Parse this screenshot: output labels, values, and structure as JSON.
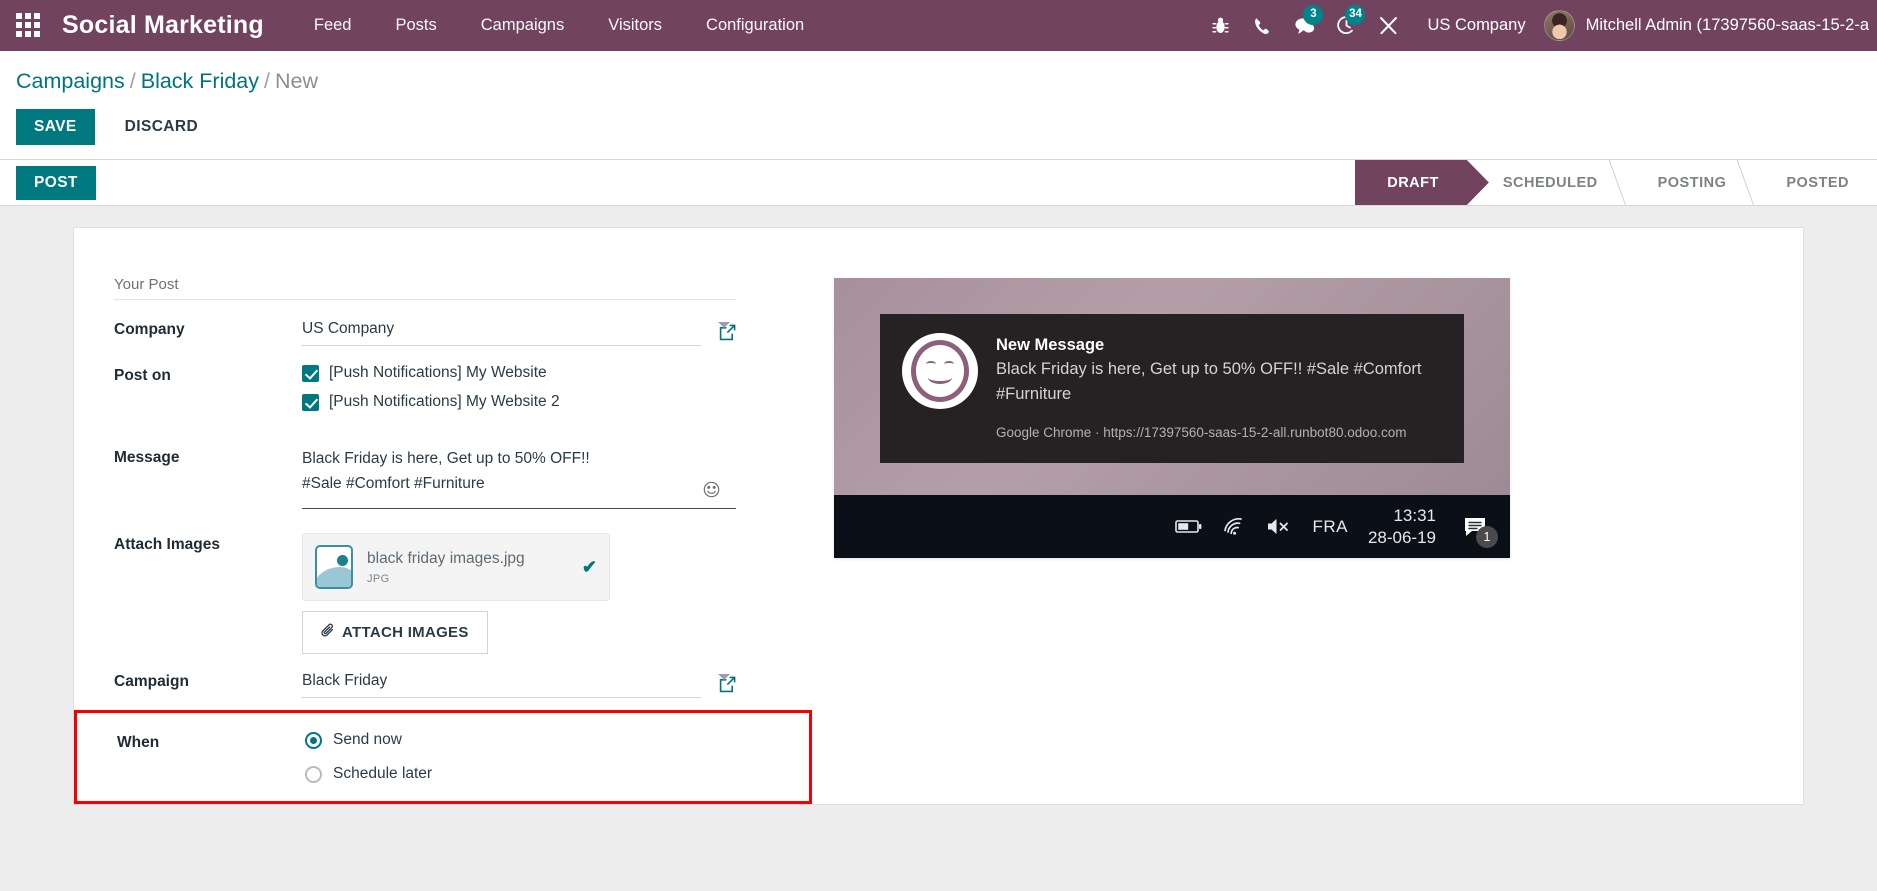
{
  "navbar": {
    "apps_icon": "apps-grid-icon",
    "brand": "Social Marketing",
    "menu": [
      {
        "label": "Feed"
      },
      {
        "label": "Posts"
      },
      {
        "label": "Campaigns"
      },
      {
        "label": "Visitors"
      },
      {
        "label": "Configuration"
      }
    ],
    "sys_icons": [
      {
        "name": "bug-icon",
        "badge": null
      },
      {
        "name": "phone-icon",
        "badge": null
      },
      {
        "name": "messages-icon",
        "badge": "3"
      },
      {
        "name": "activities-clock-icon",
        "badge": "34"
      },
      {
        "name": "tools-icon",
        "badge": null
      }
    ],
    "company": "US Company",
    "user": "Mitchell Admin (17397560-saas-15-2-a",
    "accent_color": "#71435f"
  },
  "breadcrumb": {
    "root": "Campaigns",
    "parent": "Black Friday",
    "current": "New",
    "separator": "/"
  },
  "control_panel": {
    "save_label": "SAVE",
    "discard_label": "DISCARD"
  },
  "statusbar": {
    "post_label": "POST",
    "stages": [
      {
        "label": "DRAFT",
        "active": true
      },
      {
        "label": "SCHEDULED",
        "active": false
      },
      {
        "label": "POSTING",
        "active": false
      },
      {
        "label": "POSTED",
        "active": false
      }
    ],
    "active_color": "#71435f"
  },
  "form": {
    "group_title": "Your Post",
    "company": {
      "label": "Company",
      "value": "US Company"
    },
    "post_on": {
      "label": "Post on",
      "accounts": [
        {
          "label": "[Push Notifications] My Website",
          "checked": true
        },
        {
          "label": "[Push Notifications] My Website 2",
          "checked": true
        }
      ]
    },
    "message": {
      "label": "Message",
      "line1": "Black Friday is here, Get up to 50% OFF!!",
      "line2": "#Sale #Comfort #Furniture",
      "emoji_icon": "emoji-smiley-icon"
    },
    "attach_images": {
      "label": "Attach Images",
      "file_name": "black friday images.jpg",
      "file_type": "JPG",
      "button_label": "ATTACH IMAGES",
      "button_icon": "paperclip-icon"
    },
    "campaign": {
      "label": "Campaign",
      "value": "Black Friday"
    },
    "when": {
      "label": "When",
      "options": [
        {
          "label": "Send now",
          "selected": true
        },
        {
          "label": "Schedule later",
          "selected": false
        }
      ],
      "highlight_color": "#f40000"
    }
  },
  "preview": {
    "notification": {
      "title": "New Message",
      "body": "Black Friday is here, Get up to 50% OFF!! #Sale #Comfort #Furniture",
      "source": "Google Chrome · https://17397560-saas-15-2-all.runbot80.odoo.com"
    },
    "taskbar": {
      "battery_icon": "battery-icon",
      "wifi_icon": "wifi-icon",
      "volume_icon": "volume-muted-icon",
      "language": "FRA",
      "time": "13:31",
      "date": "28-06-19",
      "notification_icon": "notification-center-icon",
      "notification_count": "1"
    }
  }
}
